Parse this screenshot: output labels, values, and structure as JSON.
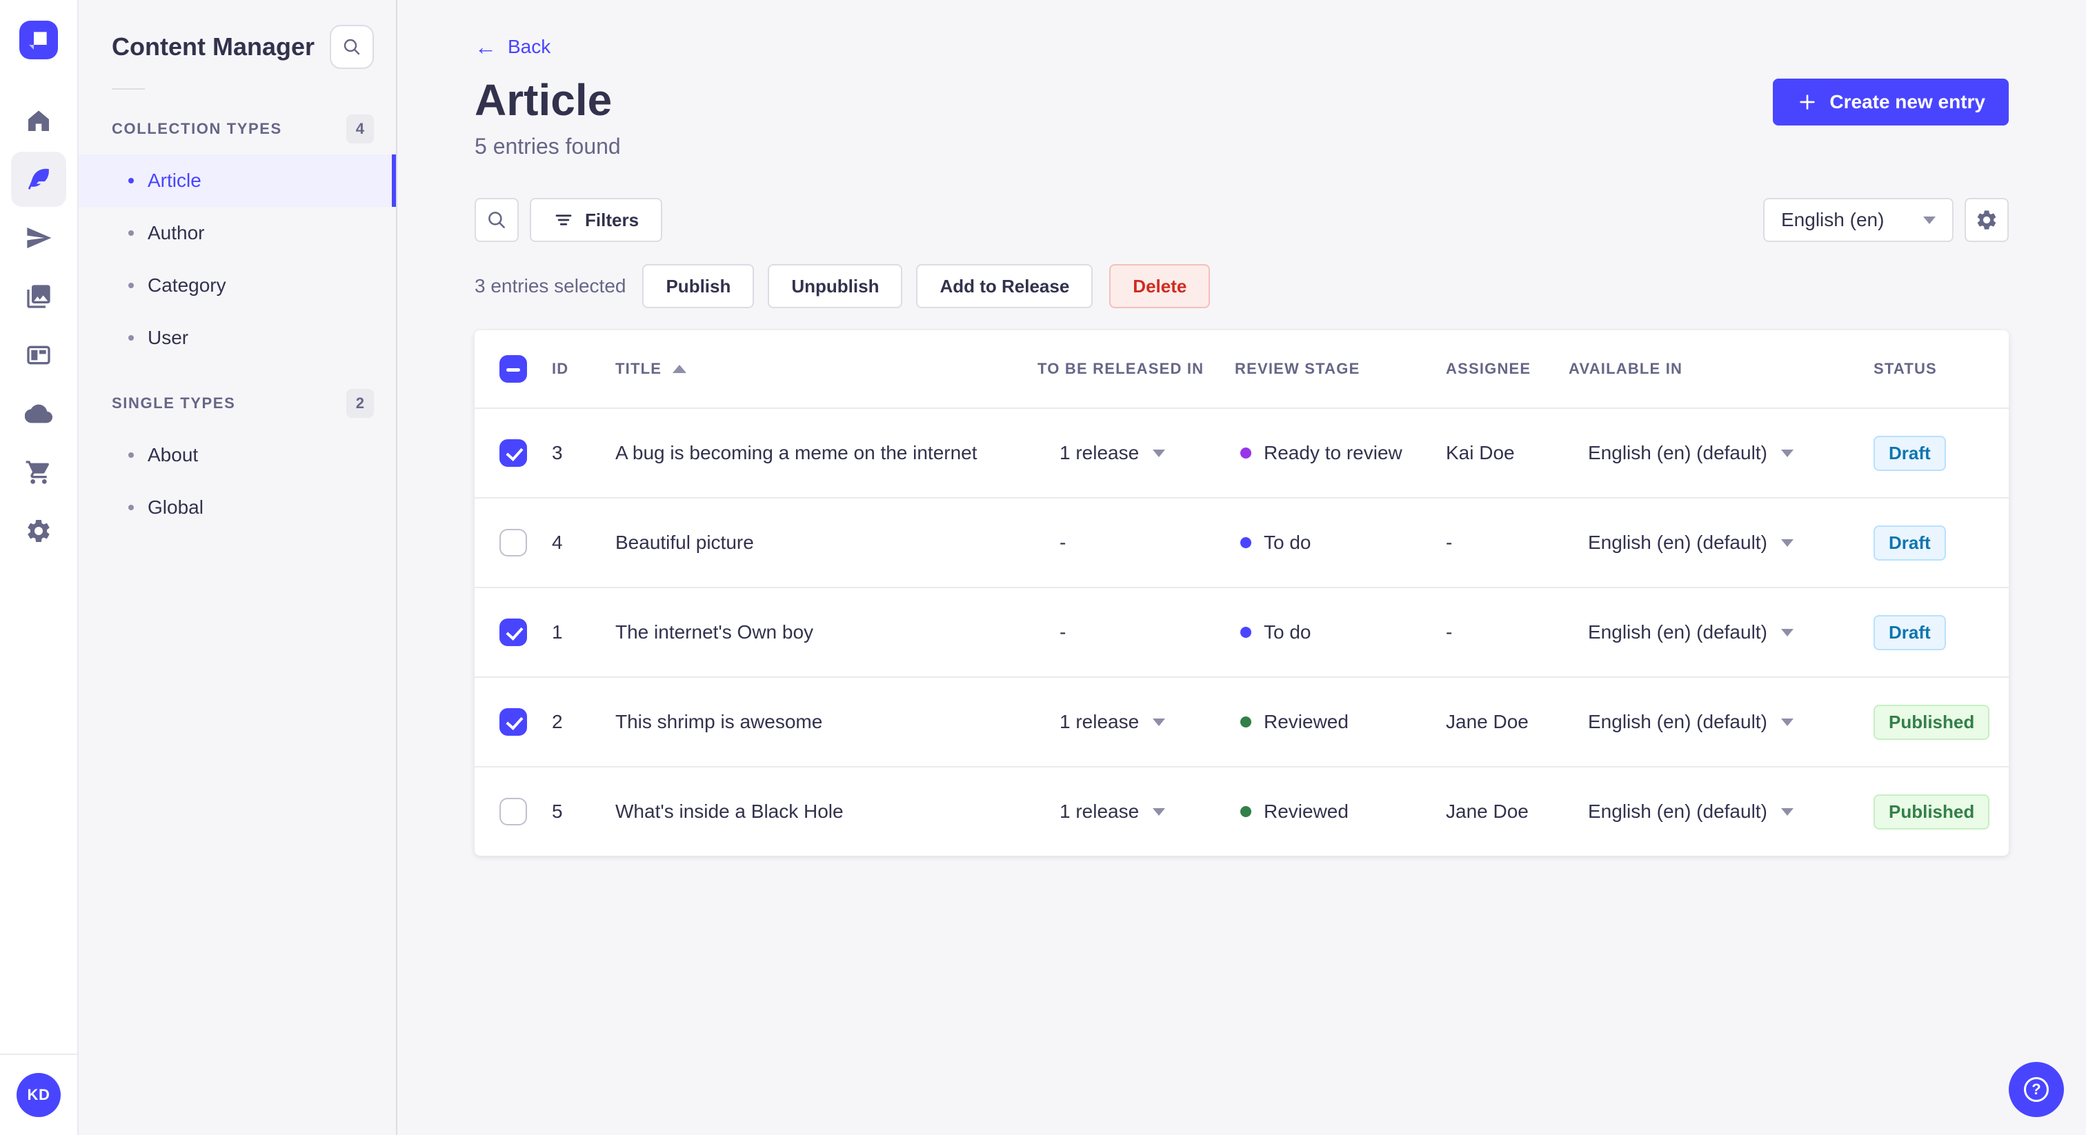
{
  "brand": {
    "primary_color": "#4945FF",
    "main_bg": "#F6F6F9"
  },
  "nav": {
    "rail": [
      {
        "name": "home",
        "icon": "home",
        "active": false
      },
      {
        "name": "content-manager",
        "icon": "feather",
        "active": true
      },
      {
        "name": "releases",
        "icon": "paper-plane",
        "active": false
      },
      {
        "name": "media-library",
        "icon": "images",
        "active": false
      },
      {
        "name": "content-type-builder",
        "icon": "layout",
        "active": false
      },
      {
        "name": "deploy",
        "icon": "cloud",
        "active": false
      },
      {
        "name": "marketplace",
        "icon": "cart",
        "active": false
      },
      {
        "name": "settings",
        "icon": "gear",
        "active": false
      }
    ],
    "user_initials": "KD"
  },
  "sidebar": {
    "title": "Content Manager",
    "sections": [
      {
        "label": "COLLECTION TYPES",
        "count": "4",
        "items": [
          {
            "label": "Article",
            "active": true
          },
          {
            "label": "Author",
            "active": false
          },
          {
            "label": "Category",
            "active": false
          },
          {
            "label": "User",
            "active": false
          }
        ]
      },
      {
        "label": "SINGLE TYPES",
        "count": "2",
        "items": [
          {
            "label": "About",
            "active": false
          },
          {
            "label": "Global",
            "active": false
          }
        ]
      }
    ]
  },
  "header": {
    "back_label": "Back",
    "title": "Article",
    "subtitle": "5 entries found",
    "create_button_label": "Create new entry"
  },
  "toolbar": {
    "filters_label": "Filters",
    "locale_selected": "English (en)"
  },
  "selection": {
    "text": "3 entries selected",
    "publish_label": "Publish",
    "unpublish_label": "Unpublish",
    "add_to_release_label": "Add to Release",
    "delete_label": "Delete"
  },
  "table": {
    "columns": [
      "ID",
      "TITLE",
      "TO BE RELEASED IN",
      "REVIEW STAGE",
      "ASSIGNEE",
      "AVAILABLE IN",
      "STATUS"
    ],
    "sort_column": "TITLE",
    "sort_direction": "asc",
    "rows": [
      {
        "checked": true,
        "id": "3",
        "title": "A bug is becoming a meme on the internet",
        "release": "1 release",
        "stage": "Ready to review",
        "stage_color": "#9736E8",
        "assignee": "Kai Doe",
        "locale": "English (en) (default)",
        "status": "Draft"
      },
      {
        "checked": false,
        "id": "4",
        "title": "Beautiful picture",
        "release": "-",
        "stage": "To do",
        "stage_color": "#4945FF",
        "assignee": "-",
        "locale": "English (en) (default)",
        "status": "Draft"
      },
      {
        "checked": true,
        "id": "1",
        "title": "The internet's Own boy",
        "release": "-",
        "stage": "To do",
        "stage_color": "#4945FF",
        "assignee": "-",
        "locale": "English (en) (default)",
        "status": "Draft"
      },
      {
        "checked": true,
        "id": "2",
        "title": "This shrimp is awesome",
        "release": "1 release",
        "stage": "Reviewed",
        "stage_color": "#328048",
        "assignee": "Jane Doe",
        "locale": "English (en) (default)",
        "status": "Published"
      },
      {
        "checked": false,
        "id": "5",
        "title": "What's inside a Black Hole",
        "release": "1 release",
        "stage": "Reviewed",
        "stage_color": "#328048",
        "assignee": "Jane Doe",
        "locale": "English (en) (default)",
        "status": "Published"
      }
    ],
    "status_styles": {
      "Draft": {
        "bg": "#EAF5FF",
        "border": "#B8E1FF",
        "text": "#0C75AF"
      },
      "Published": {
        "bg": "#EAFBE7",
        "border": "#C6F0C2",
        "text": "#328048"
      }
    }
  },
  "help": {
    "icon": "question-circle"
  }
}
